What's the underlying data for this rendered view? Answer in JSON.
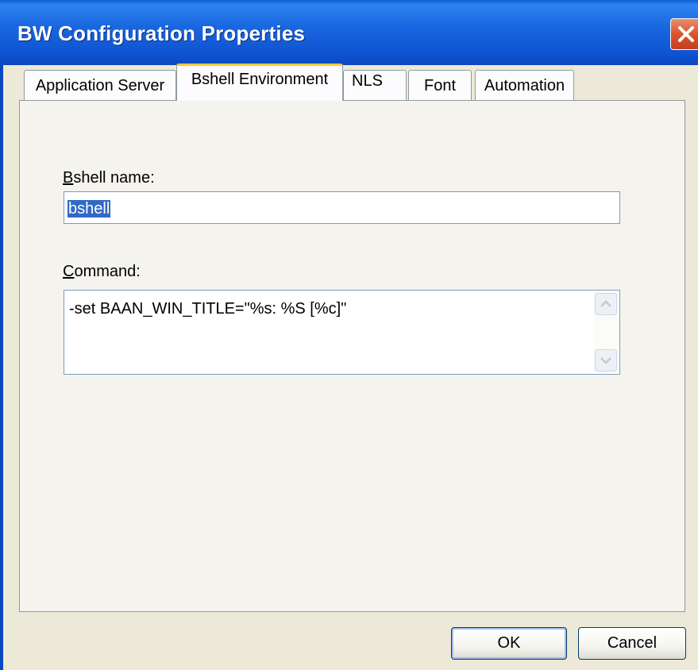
{
  "window": {
    "title": "BW Configuration Properties"
  },
  "tabs": [
    {
      "label": "Application Server"
    },
    {
      "label": "Bshell Environment"
    },
    {
      "label": "NLS"
    },
    {
      "label": "Font"
    },
    {
      "label": "Automation"
    }
  ],
  "active_tab": "Bshell Environment",
  "form": {
    "bshell_name_label_hotkey": "B",
    "bshell_name_label_rest": "shell name:",
    "bshell_name_value": "bshell",
    "command_label_hotkey": "C",
    "command_label_rest": "ommand:",
    "command_value": "-set BAAN_WIN_TITLE=\"%s: %S [%c]\""
  },
  "buttons": {
    "ok": "OK",
    "cancel": "Cancel"
  },
  "colors": {
    "titlebar": "#0f55d2",
    "selection": "#316ac5",
    "face": "#ece9d8",
    "active_tab_accent": "#ffc83c"
  },
  "icons": {
    "close": "close-icon",
    "scroll_up": "chevron-up-icon",
    "scroll_down": "chevron-down-icon"
  }
}
